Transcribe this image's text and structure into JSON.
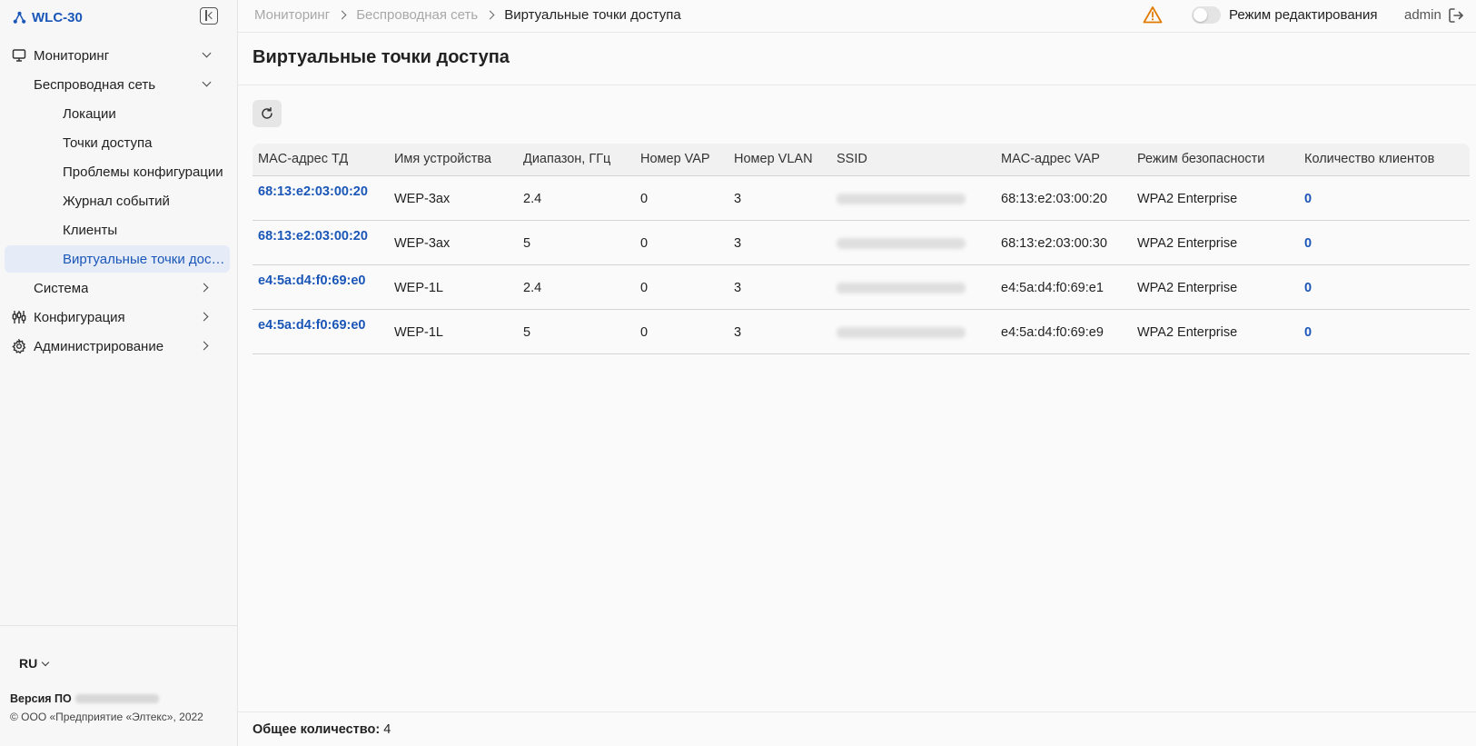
{
  "app": {
    "title": "WLC-30"
  },
  "sidebar": {
    "items": [
      {
        "label": "Мониторинг",
        "icon": "monitor-icon",
        "expanded": true
      },
      {
        "label": "Беспроводная сеть",
        "expanded": true
      },
      {
        "label": "Локации"
      },
      {
        "label": "Точки доступа"
      },
      {
        "label": "Проблемы конфигурации"
      },
      {
        "label": "Журнал событий"
      },
      {
        "label": "Клиенты"
      },
      {
        "label": "Виртуальные точки доступа",
        "active": true
      },
      {
        "label": "Система"
      },
      {
        "label": "Конфигурация",
        "icon": "sliders-icon"
      },
      {
        "label": "Администрирование",
        "icon": "gear-icon"
      }
    ],
    "language": "RU",
    "version_label": "Версия ПО",
    "copyright": "© ООО «Предприятие «Элтекс», 2022"
  },
  "header": {
    "breadcrumbs": [
      "Мониторинг",
      "Беспроводная сеть",
      "Виртуальные точки доступа"
    ],
    "edit_mode_label": "Режим редактирования",
    "edit_mode_on": false,
    "user": "admin",
    "warning_color": "#e07b00"
  },
  "page": {
    "title": "Виртуальные точки доступа"
  },
  "table": {
    "columns": [
      "MAC-адрес ТД",
      "Имя устройства",
      "Диапазон, ГГц",
      "Номер VAP",
      "Номер VLAN",
      "SSID",
      "MAC-адрес VAP",
      "Режим безопасности",
      "Количество клиентов"
    ],
    "rows": [
      {
        "ap_mac": "68:13:e2:03:00:20",
        "device": "WEP-3ax",
        "band": "2.4",
        "vap": "0",
        "vlan": "3",
        "vap_mac": "68:13:e2:03:00:20",
        "security": "WPA2 Enterprise",
        "clients": "0"
      },
      {
        "ap_mac": "68:13:e2:03:00:20",
        "device": "WEP-3ax",
        "band": "5",
        "vap": "0",
        "vlan": "3",
        "vap_mac": "68:13:e2:03:00:30",
        "security": "WPA2 Enterprise",
        "clients": "0"
      },
      {
        "ap_mac": "e4:5a:d4:f0:69:e0",
        "device": "WEP-1L",
        "band": "2.4",
        "vap": "0",
        "vlan": "3",
        "vap_mac": "e4:5a:d4:f0:69:e1",
        "security": "WPA2 Enterprise",
        "clients": "0"
      },
      {
        "ap_mac": "e4:5a:d4:f0:69:e0",
        "device": "WEP-1L",
        "band": "5",
        "vap": "0",
        "vlan": "3",
        "vap_mac": "e4:5a:d4:f0:69:e9",
        "security": "WPA2 Enterprise",
        "clients": "0"
      }
    ]
  },
  "footer": {
    "total_label": "Общее количество:",
    "total_value": "4"
  },
  "colors": {
    "accent": "#1a56b8",
    "active_bg": "#e5ecf8"
  }
}
